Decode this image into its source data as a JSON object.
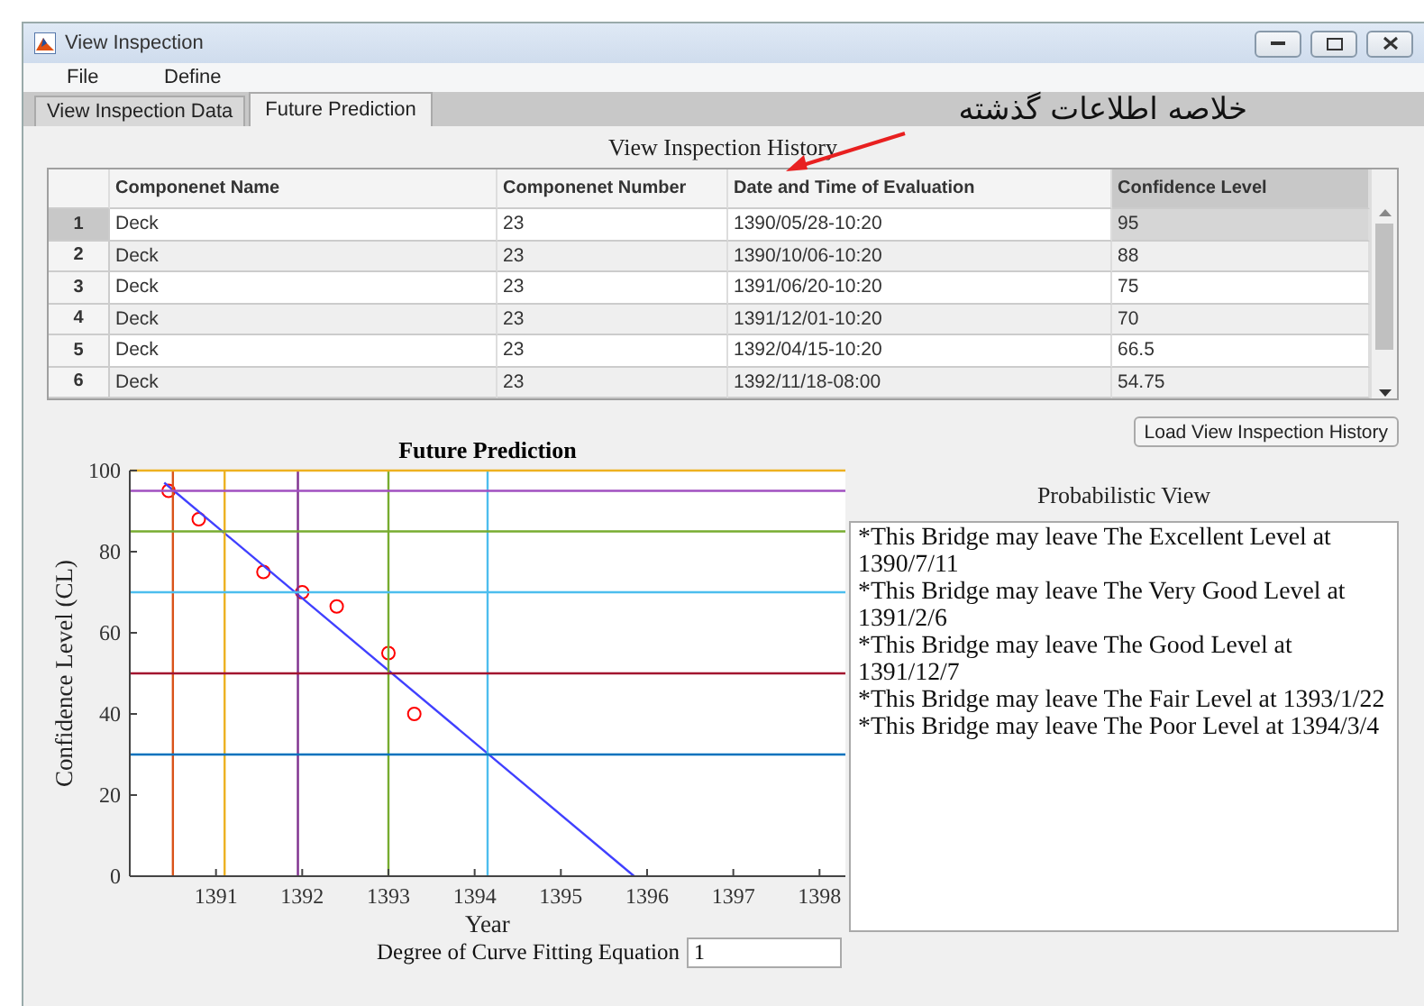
{
  "window": {
    "title": "View Inspection"
  },
  "menu": [
    "File",
    "Define"
  ],
  "tabs": [
    {
      "label": "View Inspection Data",
      "selected": false
    },
    {
      "label": "Future Prediction",
      "selected": true
    }
  ],
  "annotation": {
    "text": "خلاصه اطلاعات گذشته"
  },
  "history": {
    "title": "View Inspection History",
    "columns": [
      "Componenet Name",
      "Componenet Number",
      "Date and Time of Evaluation",
      "Confidence Level"
    ],
    "rows": [
      {
        "index": "1",
        "cells": [
          "Deck",
          "23",
          "1390/05/28-10:20",
          "95"
        ],
        "selected": true
      },
      {
        "index": "2",
        "cells": [
          "Deck",
          "23",
          "1390/10/06-10:20",
          "88"
        ],
        "selected": false
      },
      {
        "index": "3",
        "cells": [
          "Deck",
          "23",
          "1391/06/20-10:20",
          "75"
        ],
        "selected": false
      },
      {
        "index": "4",
        "cells": [
          "Deck",
          "23",
          "1391/12/01-10:20",
          "70"
        ],
        "selected": false
      },
      {
        "index": "5",
        "cells": [
          "Deck",
          "23",
          "1392/04/15-10:20",
          "66.5"
        ],
        "selected": false
      },
      {
        "index": "6",
        "cells": [
          "Deck",
          "23",
          "1392/11/18-08:00",
          "54.75"
        ],
        "selected": false
      }
    ]
  },
  "load_button": "Load View Inspection History",
  "prediction": {
    "chart_data": {
      "type": "line",
      "title": "Future Prediction",
      "xlabel": "Year",
      "ylabel": "Confidence Level (CL)",
      "xlim": [
        1390,
        1398.3
      ],
      "ylim": [
        0,
        100
      ],
      "xticks": [
        1391,
        1392,
        1393,
        1394,
        1395,
        1396,
        1397,
        1398
      ],
      "yticks": [
        0,
        20,
        40,
        60,
        80,
        100
      ],
      "series": [
        {
          "type": "scatter",
          "color": "#ff0000",
          "x": [
            1390.45,
            1390.8,
            1391.55,
            1392,
            1392.4,
            1393,
            1393.3
          ],
          "values": [
            95,
            88,
            75,
            70,
            66.5,
            55,
            40
          ]
        },
        {
          "type": "line",
          "color": "#4040ff",
          "x": [
            1390.4,
            1395.85
          ],
          "values": [
            97,
            0
          ]
        },
        {
          "type": "line",
          "color": "#d95319",
          "x": [
            1390.5,
            1390.5
          ],
          "values": [
            0,
            100
          ]
        },
        {
          "type": "line",
          "color": "#edb120",
          "x": [
            1391.1,
            1391.1
          ],
          "values": [
            0,
            100
          ]
        },
        {
          "type": "line",
          "color": "#7e2f8e",
          "x": [
            1391.95,
            1391.95
          ],
          "values": [
            0,
            100
          ]
        },
        {
          "type": "line",
          "color": "#77ac30",
          "x": [
            1393,
            1393
          ],
          "values": [
            0,
            100
          ]
        },
        {
          "type": "line",
          "color": "#4dbeee",
          "x": [
            1394.15,
            1394.15
          ],
          "values": [
            0,
            100
          ]
        },
        {
          "type": "line",
          "color": "#edb120",
          "x": [
            1390,
            1398.3
          ],
          "values": [
            100,
            100
          ]
        },
        {
          "type": "line",
          "color": "#a050c0",
          "x": [
            1390,
            1398.3
          ],
          "values": [
            95,
            95
          ]
        },
        {
          "type": "line",
          "color": "#77ac30",
          "x": [
            1390,
            1398.3
          ],
          "values": [
            85,
            85
          ]
        },
        {
          "type": "line",
          "color": "#4dbeee",
          "x": [
            1390,
            1398.3
          ],
          "values": [
            70,
            70
          ]
        },
        {
          "type": "line",
          "color": "#a2142f",
          "x": [
            1390,
            1398.3
          ],
          "values": [
            50,
            50
          ]
        },
        {
          "type": "line",
          "color": "#0072bd",
          "x": [
            1390,
            1398.3
          ],
          "values": [
            30,
            30
          ]
        }
      ]
    },
    "degree": {
      "label": "Degree of Curve Fitting Equation",
      "value": "1"
    }
  },
  "probabilistic": {
    "title": "Probabilistic View",
    "lines": [
      "*This Bridge may leave The Excellent Level at 1390/7/11",
      "*This Bridge may leave The Very Good Level at 1391/2/6",
      "*This Bridge may leave The Good Level at 1391/12/7",
      "*This Bridge may leave The Fair Level at 1393/1/22",
      "*This Bridge may leave The Poor Level at 1394/3/4"
    ]
  }
}
